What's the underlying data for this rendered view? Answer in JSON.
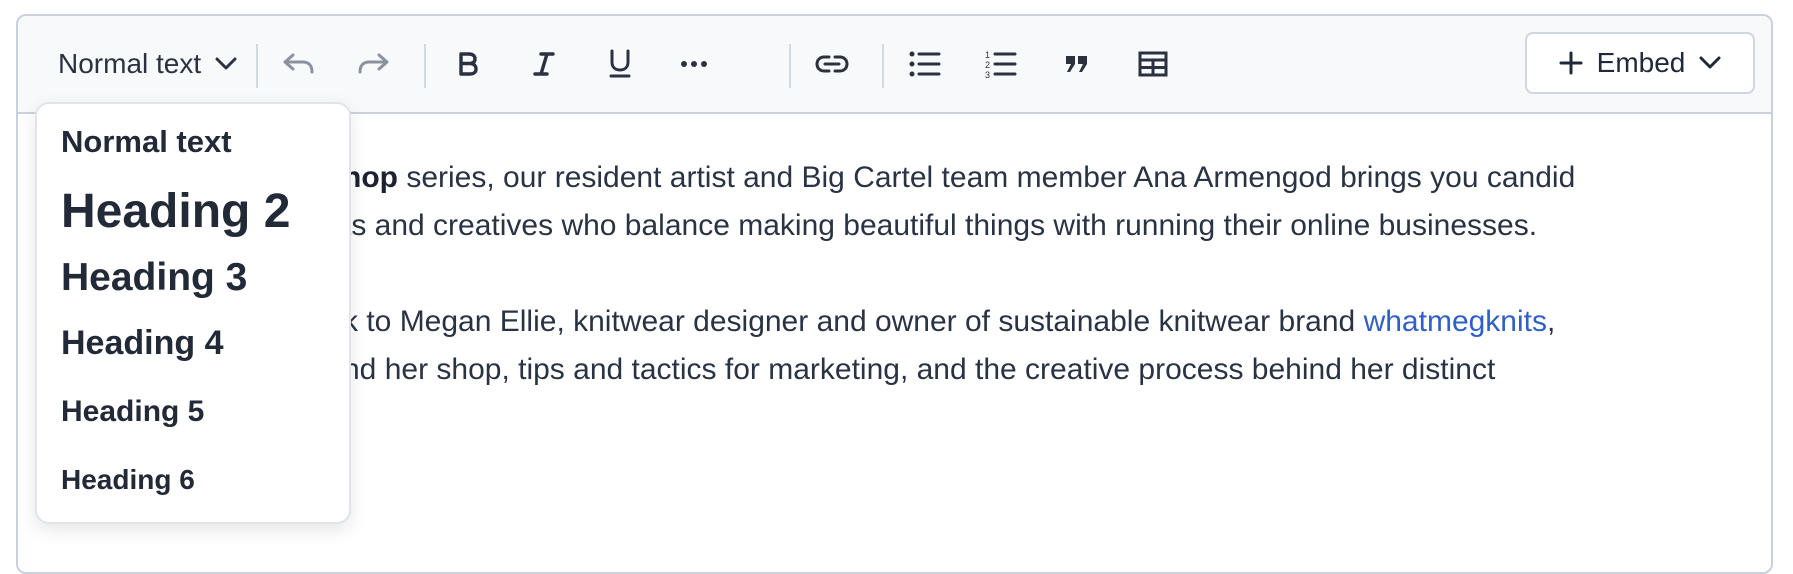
{
  "toolbar": {
    "style_select": {
      "value": "Normal text",
      "icon": "chevron-down-icon"
    },
    "buttons": [
      {
        "name": "undo",
        "icon": "undo-icon",
        "enabled": false
      },
      {
        "name": "redo",
        "icon": "redo-icon",
        "enabled": false
      },
      {
        "name": "bold",
        "icon": "bold-icon"
      },
      {
        "name": "italic",
        "icon": "italic-icon"
      },
      {
        "name": "underline",
        "icon": "underline-icon"
      },
      {
        "name": "more",
        "icon": "more-horizontal-icon"
      },
      {
        "name": "link",
        "icon": "link-icon"
      },
      {
        "name": "bulleted-list",
        "icon": "bulleted-list-icon"
      },
      {
        "name": "numbered-list",
        "icon": "numbered-list-icon"
      },
      {
        "name": "blockquote",
        "icon": "quote-icon"
      },
      {
        "name": "table",
        "icon": "table-icon"
      }
    ],
    "embed": {
      "label": "Embed",
      "icon": "plus-icon"
    }
  },
  "content": {
    "p1_bold": "hop",
    "p1_line1_rest": " series, our resident artist and Big Cartel team member Ana Armengod brings you candid",
    "p1_line2": "ts and creatives who balance making beautiful things with running their online businesses.",
    "p2_line1_start": "k to Megan Ellie, knitwear designer and owner of sustainable knitwear brand ",
    "p2_link": "whatmegknits",
    "p2_line1_end": ",",
    "p2_line2": "nd her shop, tips and tactics for marketing, and the creative process behind her distinct"
  },
  "dropdown": {
    "items": [
      {
        "label": "Normal text"
      },
      {
        "label": "Heading 2"
      },
      {
        "label": "Heading 3"
      },
      {
        "label": "Heading 4"
      },
      {
        "label": "Heading 5"
      },
      {
        "label": "Heading 6"
      }
    ]
  },
  "colors": {
    "link": "#2f5fc7",
    "toolbar_bg": "#f7f9fb",
    "border": "#c9d1dc",
    "text": "#2a3343"
  }
}
